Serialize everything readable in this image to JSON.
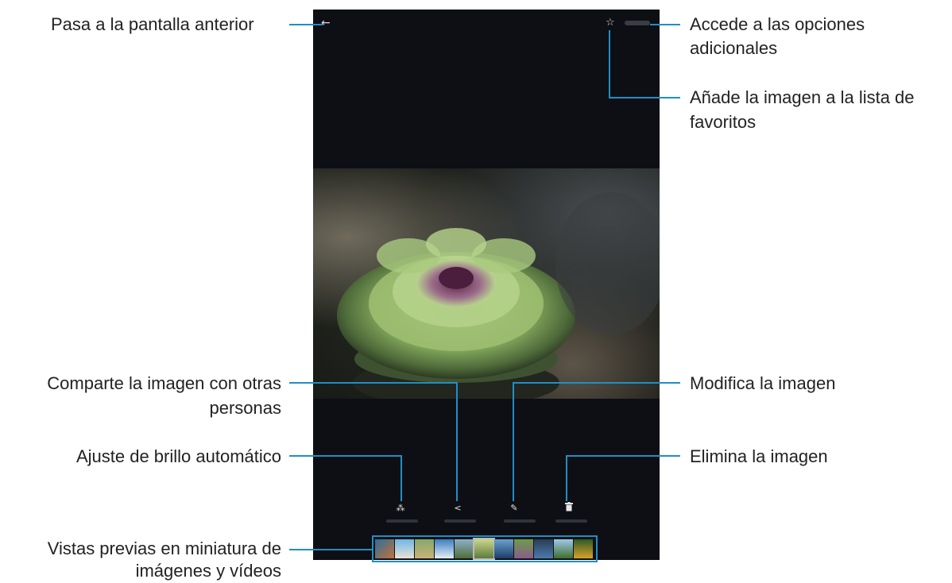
{
  "callouts": {
    "back": "Pasa a la pantalla anterior",
    "more_options_1": "Accede a las opciones",
    "more_options_2": "adicionales",
    "favorites_1": "Añade la imagen a la lista de",
    "favorites_2": "favoritos",
    "share_1": "Comparte la imagen con otras",
    "share_2": "personas",
    "edit": "Modifica la imagen",
    "auto_brightness": "Ajuste de brillo automático",
    "delete": "Elimina la imagen",
    "thumbnails_1": "Vistas previas en miniatura de",
    "thumbnails_2": "imágenes y vídeos"
  },
  "icons": {
    "back": "←",
    "star": "☆",
    "auto_adjust": "⁂",
    "share": "<",
    "edit": "✎",
    "delete": "🗑"
  },
  "colors": {
    "callout_line": "#1f8fc6",
    "screen_bg": "#0d0f14"
  },
  "thumbnails": [
    "beach-palms",
    "sunset-sea",
    "cactus",
    "mountain-lake",
    "green-field",
    "coast",
    "city",
    "thistle",
    "waterfall",
    "fern",
    "flowers"
  ]
}
